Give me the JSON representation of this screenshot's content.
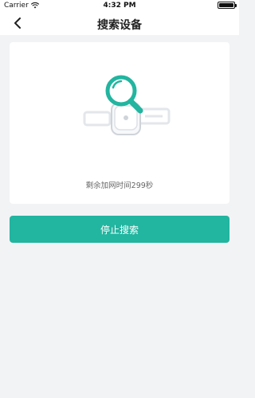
{
  "status": {
    "carrier": "Carrier",
    "time": "4:32 PM",
    "wifi_icon": "wifi-icon",
    "battery_icon": "battery-icon"
  },
  "nav": {
    "back_icon": "chevron-left-icon",
    "title": "搜索设备"
  },
  "search_card": {
    "illustration_icon": "magnifier-over-device-icon",
    "remaining_text": "剩余加网时间299秒"
  },
  "actions": {
    "stop_label": "停止搜索"
  },
  "colors": {
    "accent": "#22b5a0",
    "page_bg": "#f2f3f5",
    "card_bg": "#ffffff"
  }
}
